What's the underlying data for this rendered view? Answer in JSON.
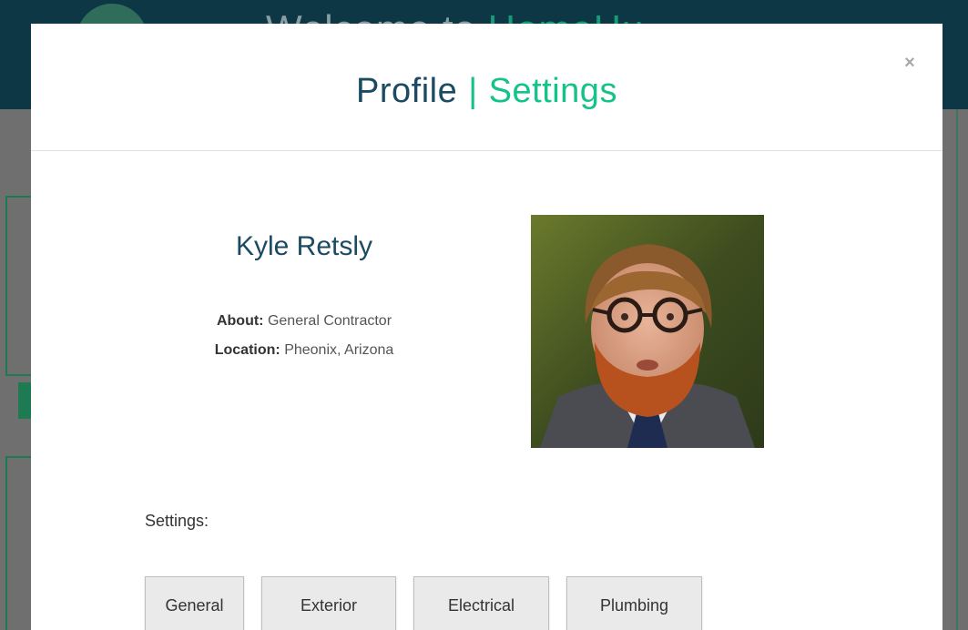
{
  "background": {
    "welcome_text": "Welcome to",
    "welcome_accent": "HomeHu"
  },
  "modal": {
    "title_left": "Profile",
    "title_separator": "|",
    "title_right": "Settings",
    "close_label": "×"
  },
  "profile": {
    "name": "Kyle Retsly",
    "about_label": "About:",
    "about_value": "General Contractor",
    "location_label": "Location:",
    "location_value": "Pheonix, Arizona"
  },
  "settings": {
    "label": "Settings:",
    "buttons": [
      "General",
      "Exterior",
      "Electrical",
      "Plumbing"
    ]
  },
  "colors": {
    "header_bg": "#0e3746",
    "accent_green": "#14c38a",
    "title_blue": "#1b4a63",
    "overlay": "#6f6f6f"
  }
}
